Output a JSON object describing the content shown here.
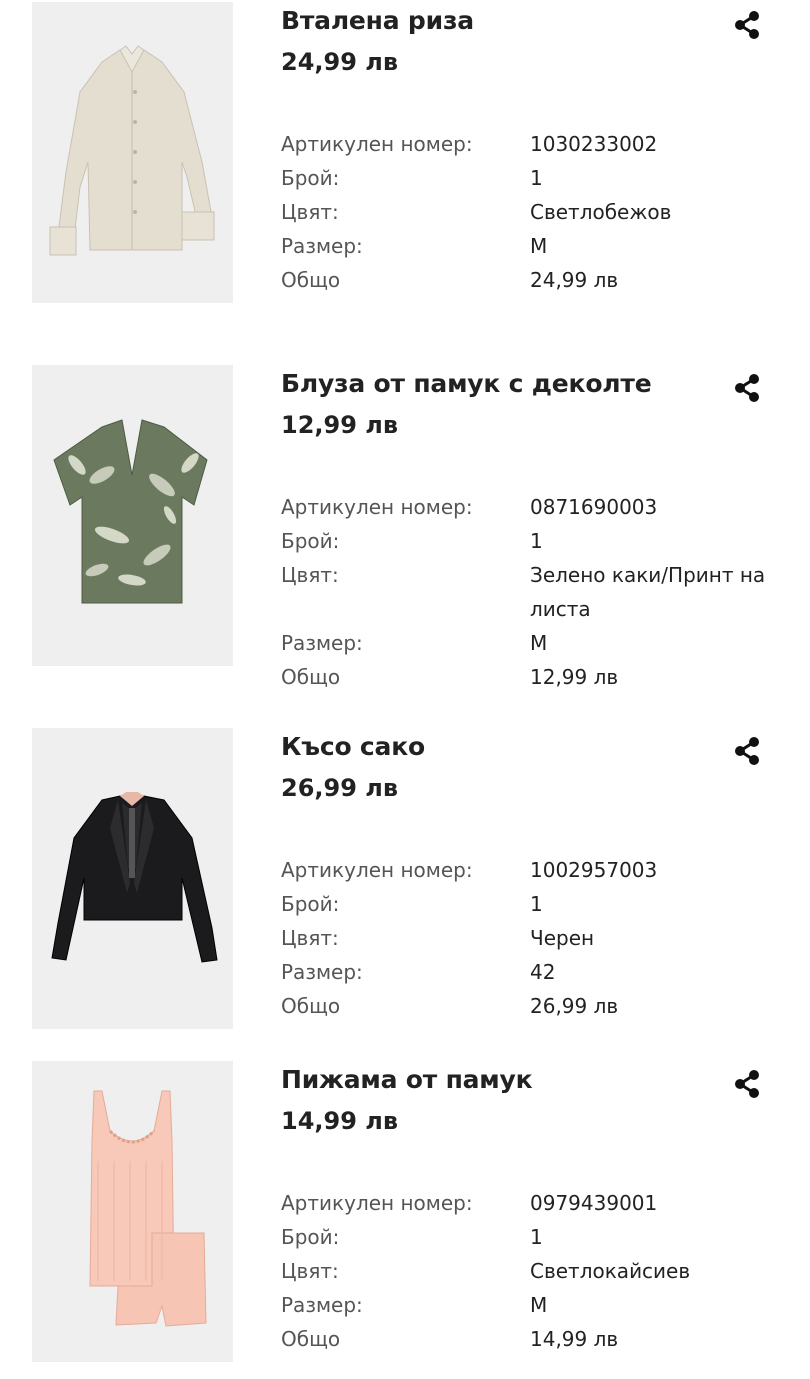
{
  "labels": {
    "article_number": "Артикулен номер:",
    "quantity": "Брой:",
    "color": "Цвят:",
    "size": "Размер:",
    "total": "Общо"
  },
  "items": [
    {
      "title": "Вталена риза",
      "price": "24,99 лв",
      "article_number": "1030233002",
      "quantity": "1",
      "color": "Светлобежов",
      "size": "M",
      "total": "24,99 лв"
    },
    {
      "title": "Блуза от памук с деколте",
      "price": "12,99 лв",
      "article_number": "0871690003",
      "quantity": "1",
      "color": "Зелено каки/Принт на листа",
      "size": "M",
      "total": "12,99 лв"
    },
    {
      "title": "Късо сако",
      "price": "26,99 лв",
      "article_number": "1002957003",
      "quantity": "1",
      "color": "Черен",
      "size": "42",
      "total": "26,99 лв"
    },
    {
      "title": "Пижама от памук",
      "price": "14,99 лв",
      "article_number": "0979439001",
      "quantity": "1",
      "color": "Светлокайсиев",
      "size": "M",
      "total": "14,99 лв"
    }
  ],
  "icons": {
    "share": "share-icon"
  },
  "colors": {
    "text": "#222222",
    "label": "#555555",
    "thumb_bg": "#efefef"
  }
}
